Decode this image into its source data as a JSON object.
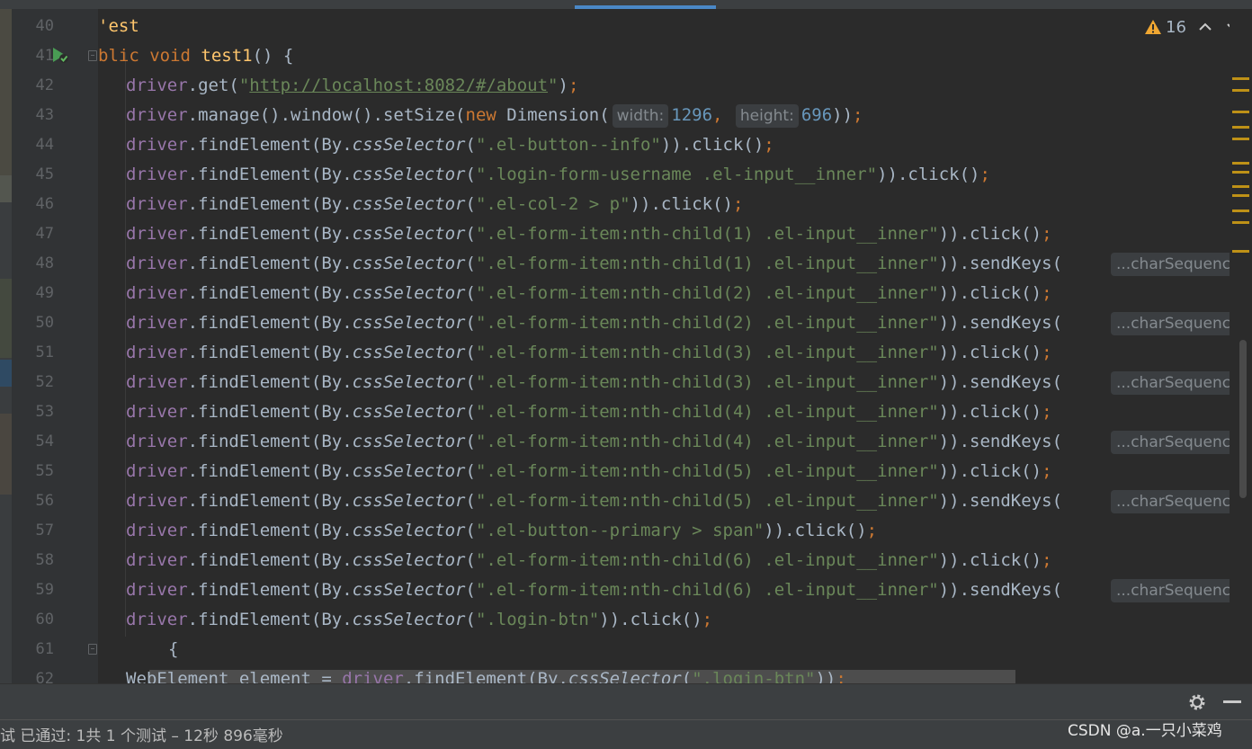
{
  "editor": {
    "warnings": {
      "count": "16"
    },
    "lines": [
      {
        "num": "40",
        "parts": [
          [
            "kw-annot",
            "'est"
          ]
        ]
      },
      {
        "num": "41",
        "parts": [
          [
            "kw",
            "blic void "
          ],
          [
            "fn",
            "test1"
          ],
          [
            "plain",
            "() {"
          ]
        ]
      },
      {
        "num": "42",
        "parts": [
          [
            "field",
            "driver"
          ],
          [
            "plain",
            ".get("
          ],
          [
            "str",
            "\""
          ],
          [
            "link",
            "http://localhost:8082/#/about"
          ],
          [
            "str",
            "\""
          ],
          [
            "plain",
            ")"
          ],
          [
            "kw",
            ";"
          ]
        ]
      },
      {
        "num": "43",
        "parts": [
          [
            "field",
            "driver"
          ],
          [
            "plain",
            ".manage().window().setSize("
          ],
          [
            "kw",
            "new "
          ],
          [
            "plain",
            "Dimension("
          ],
          [
            "hint",
            "width:"
          ],
          [
            "num",
            "1296"
          ],
          [
            "kw",
            ", "
          ],
          [
            "hint",
            "height:"
          ],
          [
            "num",
            "696"
          ],
          [
            "plain",
            "))"
          ],
          [
            "kw",
            ";"
          ]
        ]
      },
      {
        "num": "44",
        "parts": [
          [
            "field",
            "driver"
          ],
          [
            "plain",
            ".findElement(By."
          ],
          [
            "italic",
            "cssSelector"
          ],
          [
            "plain",
            "("
          ],
          [
            "str",
            "\".el-button--info\""
          ],
          [
            "plain",
            ")).click()"
          ],
          [
            "kw",
            ";"
          ]
        ]
      },
      {
        "num": "45",
        "parts": [
          [
            "field",
            "driver"
          ],
          [
            "plain",
            ".findElement(By."
          ],
          [
            "italic",
            "cssSelector"
          ],
          [
            "plain",
            "("
          ],
          [
            "str",
            "\".login-form-username .el-input__inner\""
          ],
          [
            "plain",
            ")).click()"
          ],
          [
            "kw",
            ";"
          ]
        ]
      },
      {
        "num": "46",
        "parts": [
          [
            "field",
            "driver"
          ],
          [
            "plain",
            ".findElement(By."
          ],
          [
            "italic",
            "cssSelector"
          ],
          [
            "plain",
            "("
          ],
          [
            "str",
            "\".el-col-2 > p\""
          ],
          [
            "plain",
            ")).click()"
          ],
          [
            "kw",
            ";"
          ]
        ]
      },
      {
        "num": "47",
        "parts": [
          [
            "field",
            "driver"
          ],
          [
            "plain",
            ".findElement(By."
          ],
          [
            "italic",
            "cssSelector"
          ],
          [
            "plain",
            "("
          ],
          [
            "str",
            "\".el-form-item:nth-child(1) .el-input__inner\""
          ],
          [
            "plain",
            ")).click()"
          ],
          [
            "kw",
            ";"
          ]
        ]
      },
      {
        "num": "48",
        "parts": [
          [
            "field",
            "driver"
          ],
          [
            "plain",
            ".findElement(By."
          ],
          [
            "italic",
            "cssSelector"
          ],
          [
            "plain",
            "("
          ],
          [
            "str",
            "\".el-form-item:nth-child(1) .el-input__inner\""
          ],
          [
            "plain",
            ")).sendKeys("
          ]
        ],
        "hint_right": "...charSequences:"
      },
      {
        "num": "49",
        "parts": [
          [
            "field",
            "driver"
          ],
          [
            "plain",
            ".findElement(By."
          ],
          [
            "italic",
            "cssSelector"
          ],
          [
            "plain",
            "("
          ],
          [
            "str",
            "\".el-form-item:nth-child(2) .el-input__inner\""
          ],
          [
            "plain",
            ")).click()"
          ],
          [
            "kw",
            ";"
          ]
        ]
      },
      {
        "num": "50",
        "parts": [
          [
            "field",
            "driver"
          ],
          [
            "plain",
            ".findElement(By."
          ],
          [
            "italic",
            "cssSelector"
          ],
          [
            "plain",
            "("
          ],
          [
            "str",
            "\".el-form-item:nth-child(2) .el-input__inner\""
          ],
          [
            "plain",
            ")).sendKeys("
          ]
        ],
        "hint_right": "...charSequences:"
      },
      {
        "num": "51",
        "parts": [
          [
            "field",
            "driver"
          ],
          [
            "plain",
            ".findElement(By."
          ],
          [
            "italic",
            "cssSelector"
          ],
          [
            "plain",
            "("
          ],
          [
            "str",
            "\".el-form-item:nth-child(3) .el-input__inner\""
          ],
          [
            "plain",
            ")).click()"
          ],
          [
            "kw",
            ";"
          ]
        ]
      },
      {
        "num": "52",
        "parts": [
          [
            "field",
            "driver"
          ],
          [
            "plain",
            ".findElement(By."
          ],
          [
            "italic",
            "cssSelector"
          ],
          [
            "plain",
            "("
          ],
          [
            "str",
            "\".el-form-item:nth-child(3) .el-input__inner\""
          ],
          [
            "plain",
            ")).sendKeys("
          ]
        ],
        "hint_right": "...charSequences:"
      },
      {
        "num": "53",
        "parts": [
          [
            "field",
            "driver"
          ],
          [
            "plain",
            ".findElement(By."
          ],
          [
            "italic",
            "cssSelector"
          ],
          [
            "plain",
            "("
          ],
          [
            "str",
            "\".el-form-item:nth-child(4) .el-input__inner\""
          ],
          [
            "plain",
            ")).click()"
          ],
          [
            "kw",
            ";"
          ]
        ]
      },
      {
        "num": "54",
        "parts": [
          [
            "field",
            "driver"
          ],
          [
            "plain",
            ".findElement(By."
          ],
          [
            "italic",
            "cssSelector"
          ],
          [
            "plain",
            "("
          ],
          [
            "str",
            "\".el-form-item:nth-child(4) .el-input__inner\""
          ],
          [
            "plain",
            ")).sendKeys("
          ]
        ],
        "hint_right": "...charSequences:"
      },
      {
        "num": "55",
        "parts": [
          [
            "field",
            "driver"
          ],
          [
            "plain",
            ".findElement(By."
          ],
          [
            "italic",
            "cssSelector"
          ],
          [
            "plain",
            "("
          ],
          [
            "str",
            "\".el-form-item:nth-child(5) .el-input__inner\""
          ],
          [
            "plain",
            ")).click()"
          ],
          [
            "kw",
            ";"
          ]
        ]
      },
      {
        "num": "56",
        "parts": [
          [
            "field",
            "driver"
          ],
          [
            "plain",
            ".findElement(By."
          ],
          [
            "italic",
            "cssSelector"
          ],
          [
            "plain",
            "("
          ],
          [
            "str",
            "\".el-form-item:nth-child(5) .el-input__inner\""
          ],
          [
            "plain",
            ")).sendKeys("
          ]
        ],
        "hint_right": "...charSequences:"
      },
      {
        "num": "57",
        "parts": [
          [
            "field",
            "driver"
          ],
          [
            "plain",
            ".findElement(By."
          ],
          [
            "italic",
            "cssSelector"
          ],
          [
            "plain",
            "("
          ],
          [
            "str",
            "\".el-button--primary > span\""
          ],
          [
            "plain",
            ")).click()"
          ],
          [
            "kw",
            ";"
          ]
        ]
      },
      {
        "num": "58",
        "parts": [
          [
            "field",
            "driver"
          ],
          [
            "plain",
            ".findElement(By."
          ],
          [
            "italic",
            "cssSelector"
          ],
          [
            "plain",
            "("
          ],
          [
            "str",
            "\".el-form-item:nth-child(6) .el-input__inner\""
          ],
          [
            "plain",
            ")).click()"
          ],
          [
            "kw",
            ";"
          ]
        ]
      },
      {
        "num": "59",
        "parts": [
          [
            "field",
            "driver"
          ],
          [
            "plain",
            ".findElement(By."
          ],
          [
            "italic",
            "cssSelector"
          ],
          [
            "plain",
            "("
          ],
          [
            "str",
            "\".el-form-item:nth-child(6) .el-input__inner\""
          ],
          [
            "plain",
            ")).sendKeys("
          ]
        ],
        "hint_right": "...charSequences:"
      },
      {
        "num": "60",
        "parts": [
          [
            "field",
            "driver"
          ],
          [
            "plain",
            ".findElement(By."
          ],
          [
            "italic",
            "cssSelector"
          ],
          [
            "plain",
            "("
          ],
          [
            "str",
            "\".login-btn\""
          ],
          [
            "plain",
            ")).click()"
          ],
          [
            "kw",
            ";"
          ]
        ]
      },
      {
        "num": "61",
        "parts": [
          [
            "plain",
            "{"
          ]
        ]
      },
      {
        "num": "62",
        "parts": [
          [
            "plain",
            "WebElement element = "
          ],
          [
            "field",
            "driver"
          ],
          [
            "plain",
            ".findElement(By."
          ],
          [
            "italic",
            "cssSelector"
          ],
          [
            "plain",
            "("
          ],
          [
            "str",
            "\".login-btn\""
          ],
          [
            "plain",
            "))"
          ],
          [
            "kw",
            ";"
          ]
        ]
      }
    ]
  },
  "status": {
    "text": "试 已通过: 1共 1 个测试 – 12秒 896毫秒"
  },
  "watermark": "CSDN @a.一只小菜鸡",
  "icons": {
    "warning": "warning-triangle-icon",
    "prev": "chevron-up-icon",
    "next": "chevron-down-icon",
    "settings": "gear-icon",
    "minimize": "minimize-icon",
    "run": "run-test-icon"
  },
  "colors": {
    "background": "#2b2b2b",
    "keyword": "#cc7832",
    "string": "#6a8759",
    "field": "#9876aa",
    "function": "#ffc66d",
    "number": "#6897bb",
    "warning_marker": "#be9117"
  }
}
